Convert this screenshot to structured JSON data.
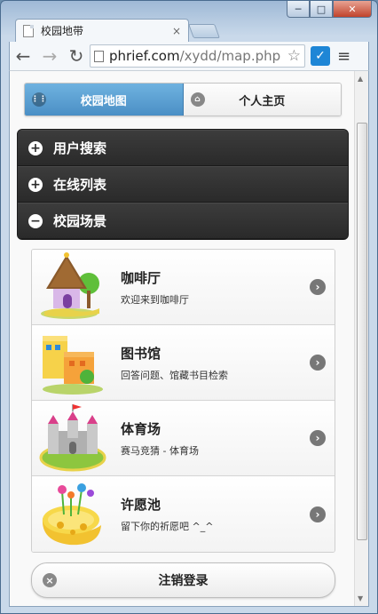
{
  "browser": {
    "tab_title": "校园地带",
    "tab_close": "×",
    "url_host": "phrief.com",
    "url_path": "/xydd/map.php",
    "win_min": "─",
    "win_max": "□",
    "win_close": "✕"
  },
  "nav": {
    "map_label": "校园地图",
    "home_label": "个人主页"
  },
  "accordion": [
    {
      "icon": "+",
      "label": "用户搜索"
    },
    {
      "icon": "+",
      "label": "在线列表"
    },
    {
      "icon": "−",
      "label": "校园场景"
    }
  ],
  "places": [
    {
      "title": "咖啡厅",
      "desc": "欢迎来到咖啡厅",
      "icon": "cafe-house-icon"
    },
    {
      "title": "图书馆",
      "desc": "回答问题、馆藏书目检索",
      "icon": "library-building-icon"
    },
    {
      "title": "体育场",
      "desc": "赛马竞猜 - 体育场",
      "icon": "stadium-castle-icon"
    },
    {
      "title": "许愿池",
      "desc": "留下你的祈愿吧 ^_^",
      "icon": "wishing-pool-icon"
    }
  ],
  "logout": {
    "label": "注销登录"
  },
  "colors": {
    "accent": "#4a8fc5",
    "accordion_bg": "#2b2b2b"
  }
}
